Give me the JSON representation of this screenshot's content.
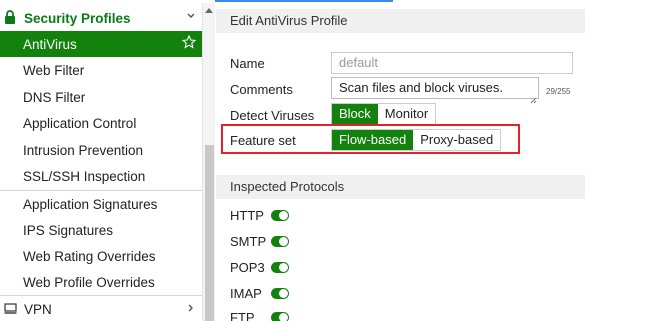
{
  "sidebar": {
    "section_label": "Security Profiles",
    "items": [
      {
        "label": "AntiVirus",
        "active": true
      },
      {
        "label": "Web Filter"
      },
      {
        "label": "DNS Filter"
      },
      {
        "label": "Application Control"
      },
      {
        "label": "Intrusion Prevention"
      },
      {
        "label": "SSL/SSH Inspection"
      },
      {
        "label": "Application Signatures"
      },
      {
        "label": "IPS Signatures"
      },
      {
        "label": "Web Rating Overrides"
      },
      {
        "label": "Web Profile Overrides"
      }
    ],
    "vpn_label": "VPN"
  },
  "form": {
    "title": "Edit AntiVirus Profile",
    "name_label": "Name",
    "name_placeholder": "default",
    "comments_label": "Comments",
    "comments_value": "Scan files and block viruses.",
    "comments_count": "29/255",
    "detect_label": "Detect Viruses",
    "detect_options": [
      "Block",
      "Monitor"
    ],
    "detect_selected": "Block",
    "feature_label": "Feature set",
    "feature_options": [
      "Flow-based",
      "Proxy-based"
    ],
    "feature_selected": "Flow-based"
  },
  "protocols": {
    "title": "Inspected Protocols",
    "items": [
      {
        "label": "HTTP",
        "enabled": true
      },
      {
        "label": "SMTP",
        "enabled": true
      },
      {
        "label": "POP3",
        "enabled": true
      },
      {
        "label": "IMAP",
        "enabled": true
      },
      {
        "label": "FTP",
        "enabled": true
      }
    ]
  },
  "colors": {
    "accent_green": "#12820d",
    "section_green": "#0c7a16",
    "highlight_red": "#e0222a"
  }
}
